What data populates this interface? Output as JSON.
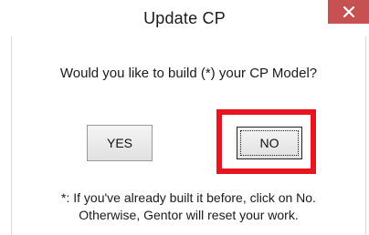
{
  "dialog": {
    "title": "Update CP",
    "close_icon": "close-icon",
    "prompt": "Would you like to build (*) your CP Model?",
    "buttons": {
      "yes_label": "YES",
      "no_label": "NO"
    },
    "footnote": {
      "line1": "*: If you've already built it before, click on No.",
      "line2": "Otherwise, Gentor will reset your work."
    }
  },
  "colors": {
    "close_button": "#c75050",
    "highlight": "#e8141e"
  }
}
